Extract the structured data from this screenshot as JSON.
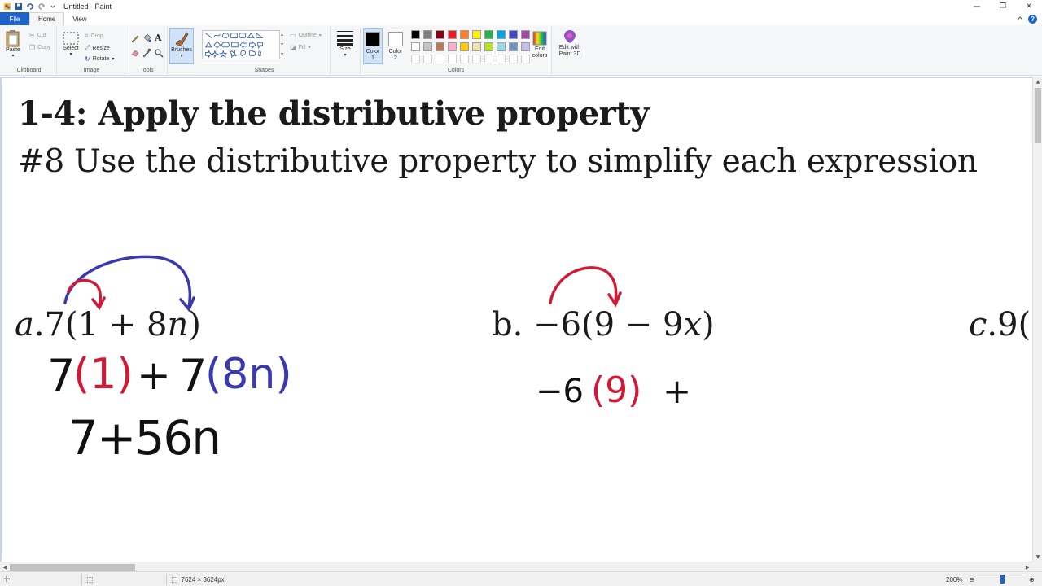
{
  "window": {
    "title": "Untitled - Paint",
    "controls": {
      "minimize": "—",
      "restore": "❐",
      "close": "✕"
    }
  },
  "tabs": {
    "file": "File",
    "home": "Home",
    "view": "View"
  },
  "ribbon": {
    "clipboard": {
      "label": "Clipboard",
      "paste": "Paste",
      "cut": "Cut",
      "copy": "Copy"
    },
    "image": {
      "label": "Image",
      "select": "Select",
      "crop": "Crop",
      "resize": "Resize",
      "rotate": "Rotate"
    },
    "tools": {
      "label": "Tools"
    },
    "brushes": {
      "label": "Brushes"
    },
    "shapes": {
      "label": "Shapes",
      "outline": "Outline",
      "fill": "Fill"
    },
    "size": {
      "label": "Size"
    },
    "colors": {
      "label": "Colors",
      "color1": "Color\n1",
      "color1_value": "#000000",
      "color2": "Color\n2",
      "color2_value": "#ffffff",
      "edit_colors": "Edit colors",
      "paint3d": "Edit with Paint 3D",
      "palette_row1": [
        "#000000",
        "#7f7f7f",
        "#880015",
        "#ed1c24",
        "#ff7f27",
        "#fff200",
        "#22b14c",
        "#00a2e8",
        "#3f48cc",
        "#a349a4"
      ],
      "palette_row2": [
        "#ffffff",
        "#c3c3c3",
        "#b97a57",
        "#ffaec9",
        "#ffc90e",
        "#efe4b0",
        "#b5e61d",
        "#99d9ea",
        "#7092be",
        "#c8bfe7"
      ]
    }
  },
  "canvas": {
    "heading": "1-4: Apply the distributive property",
    "subheading": "#8 Use the distributive property to simplify each expression",
    "problem_a": {
      "label": "a",
      "number": "7",
      "open": "(1 + 8",
      "var": "n",
      "close": ")"
    },
    "problem_b": {
      "label": "b.",
      "expr": "−6(9 − 9",
      "var": "x",
      "close": ")"
    },
    "problem_c": {
      "label": "c",
      "expr": "9("
    },
    "work_a": {
      "line1_seven1": "7",
      "line1_one": "(1)",
      "line1_plus": "+",
      "line1_seven2": "7",
      "line1_eightn": "(8n)",
      "line2": "7+56n"
    },
    "work_b": {
      "neg6": "−6",
      "nine": "(9)",
      "plus": "+"
    },
    "ink_colors": {
      "black": "#111111",
      "red": "#d01a35",
      "blue": "#3a3ab0"
    }
  },
  "statusbar": {
    "dimensions": "7624 × 3624px",
    "zoom": "200%",
    "zoom_fraction": 0.52
  }
}
